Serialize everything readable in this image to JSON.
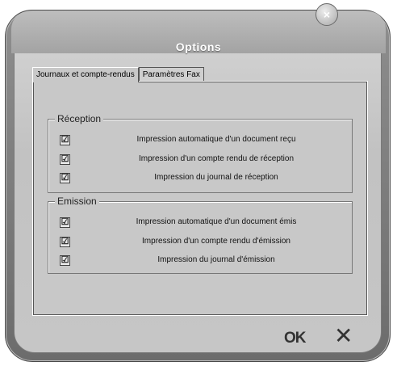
{
  "window": {
    "title": "Options",
    "close_glyph": "×"
  },
  "tabs": [
    {
      "label": "Journaux et compte-rendus",
      "active": true
    },
    {
      "label": "Paramètres Fax",
      "active": false
    }
  ],
  "reception": {
    "label": "Réception",
    "items": [
      {
        "label": "Impression automatique d'un document reçu",
        "checked": true
      },
      {
        "label": "Impression  d'un compte rendu de réception",
        "checked": true
      },
      {
        "label": "Impression du journal de réception",
        "checked": true
      }
    ]
  },
  "emission": {
    "label": "Emission",
    "items": [
      {
        "label": "Impression automatique d'un document émis",
        "checked": true
      },
      {
        "label": "Impression  d'un compte rendu d'émission",
        "checked": true
      },
      {
        "label": "Impression du journal d'émission",
        "checked": true
      }
    ]
  },
  "checkmark": "☑",
  "footer": {
    "ok_label": "OK",
    "cancel_glyph": "✕"
  }
}
